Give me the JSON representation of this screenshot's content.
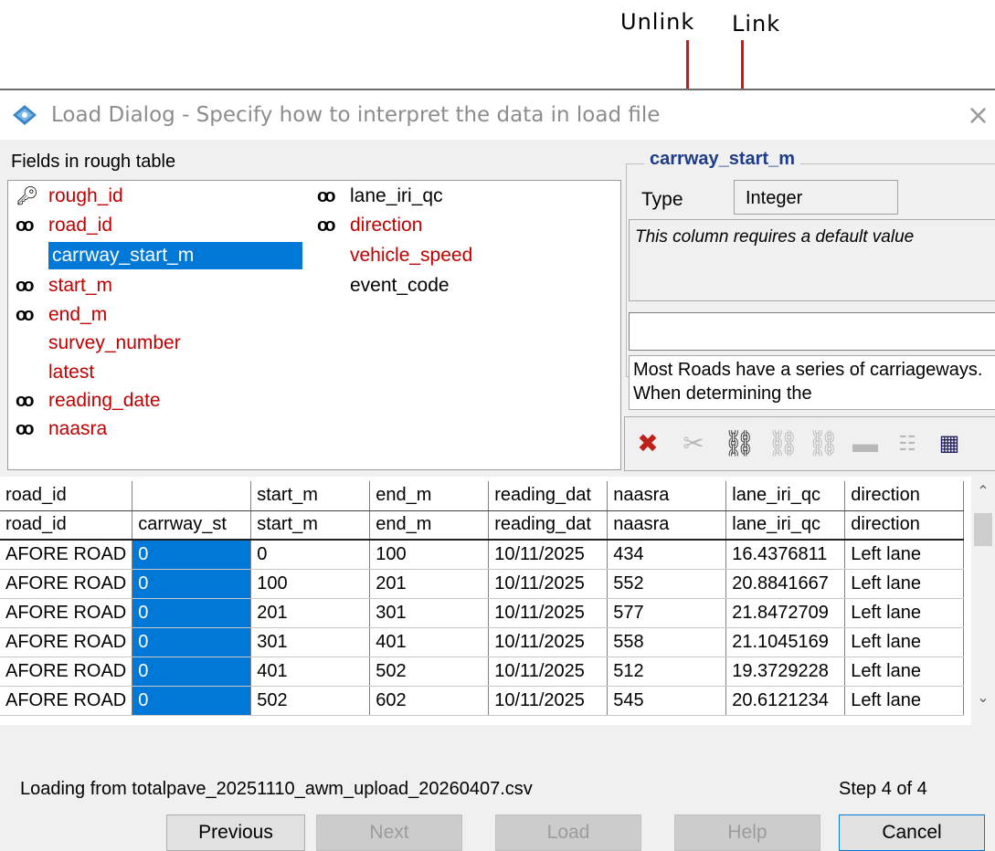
{
  "annotations": {
    "unlink": "Unlink",
    "link": "Link"
  },
  "window": {
    "title": "Load Dialog - Specify how to interpret the data in load file",
    "close": "×"
  },
  "fields_panel": {
    "label": "Fields in rough table",
    "left_column": [
      {
        "name": "rough_id",
        "icon": "key-icon",
        "color": "red"
      },
      {
        "name": "road_id",
        "icon": "link-icon",
        "color": "red"
      },
      {
        "name": "carrway_start_m",
        "icon": "",
        "color": "selected"
      },
      {
        "name": "start_m",
        "icon": "link-icon",
        "color": "red"
      },
      {
        "name": "end_m",
        "icon": "link-icon",
        "color": "red"
      },
      {
        "name": "survey_number",
        "icon": "",
        "color": "red"
      },
      {
        "name": "latest",
        "icon": "",
        "color": "red"
      },
      {
        "name": "reading_date",
        "icon": "link-icon",
        "color": "red"
      },
      {
        "name": "naasra",
        "icon": "link-icon",
        "color": "red"
      }
    ],
    "right_column": [
      {
        "name": "lane_iri_qc",
        "icon": "link-icon",
        "color": "black"
      },
      {
        "name": "direction",
        "icon": "link-icon",
        "color": "red"
      },
      {
        "name": "vehicle_speed",
        "icon": "",
        "color": "red"
      },
      {
        "name": "event_code",
        "icon": "",
        "color": "black"
      }
    ]
  },
  "details": {
    "title": "carrway_start_m",
    "type_label": "Type",
    "type_value": "Integer",
    "note": "This column requires a default value",
    "default_value": "",
    "help": "Most Roads have a series of carriageways. When determining the"
  },
  "grid": {
    "header_row1": [
      "road_id",
      "",
      "start_m",
      "end_m",
      "reading_dat",
      "naasra",
      "lane_iri_qc",
      "direction"
    ],
    "header_row2": [
      "road_id",
      "carrway_st",
      "start_m",
      "end_m",
      "reading_dat",
      "naasra",
      "lane_iri_qc",
      "direction"
    ],
    "rows": [
      [
        "AFORE ROAD",
        "0",
        "0",
        "100",
        "10/11/2025",
        "434",
        "16.4376811",
        "Left lane"
      ],
      [
        "AFORE ROAD",
        "0",
        "100",
        "201",
        "10/11/2025",
        "552",
        "20.8841667",
        "Left lane"
      ],
      [
        "AFORE ROAD",
        "0",
        "201",
        "301",
        "10/11/2025",
        "577",
        "21.8472709",
        "Left lane"
      ],
      [
        "AFORE ROAD",
        "0",
        "301",
        "401",
        "10/11/2025",
        "558",
        "21.1045169",
        "Left lane"
      ],
      [
        "AFORE ROAD",
        "0",
        "401",
        "502",
        "10/11/2025",
        "512",
        "19.3729228",
        "Left lane"
      ],
      [
        "AFORE ROAD",
        "0",
        "502",
        "602",
        "10/11/2025",
        "545",
        "20.6121234",
        "Left lane"
      ]
    ]
  },
  "status": {
    "loading": "Loading from totalpave_20251110_awm_upload_20260407.csv",
    "step": "Step 4 of 4"
  },
  "buttons": {
    "previous": "Previous",
    "next": "Next",
    "load": "Load",
    "help": "Help",
    "cancel": "Cancel"
  },
  "colors": {
    "selection": "#0078d7",
    "required_field": "#c00000",
    "annotation_arrow": "#e01010"
  }
}
